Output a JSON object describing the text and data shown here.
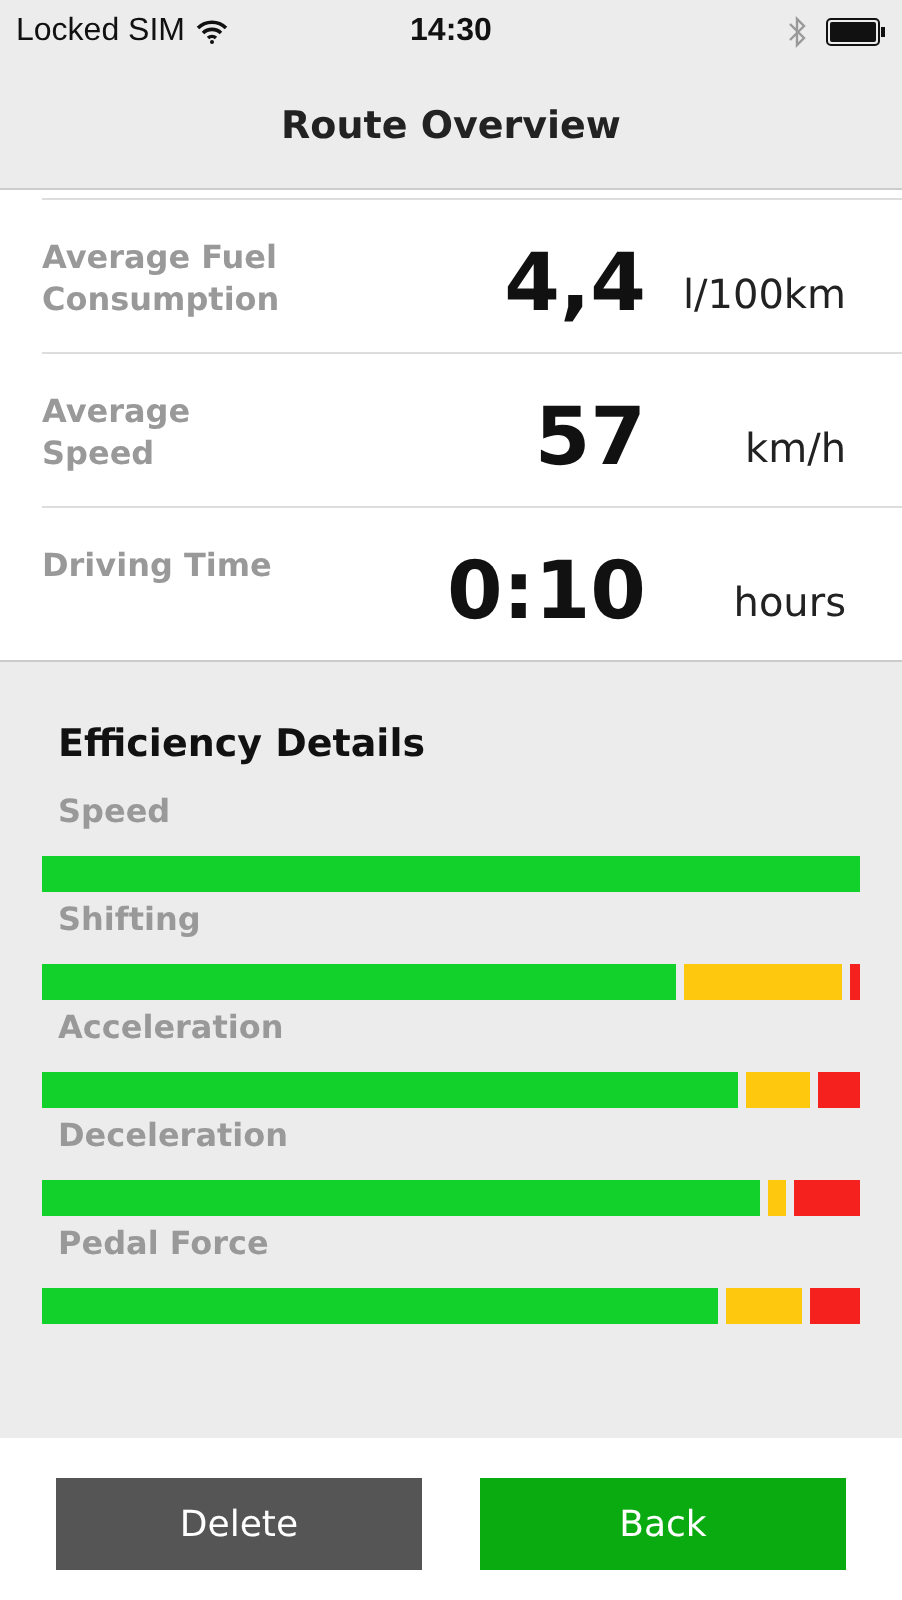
{
  "status_bar": {
    "carrier": "Locked SIM",
    "time": "14:30"
  },
  "nav": {
    "title": "Route Overview"
  },
  "metrics": [
    {
      "label": "Average Fuel Consumption",
      "value": "4,4",
      "unit": "l/100km"
    },
    {
      "label": "Average Speed",
      "value": "57",
      "unit": "km/h"
    },
    {
      "label": "Driving Time",
      "value": "0:10",
      "unit": "hours"
    }
  ],
  "efficiency": {
    "title": "Efficiency Details",
    "items": [
      {
        "label": "Speed",
        "level": 1.0
      },
      {
        "label": "Shifting",
        "level": 0.775
      },
      {
        "label": "Acceleration",
        "level": 0.851
      },
      {
        "label": "Deceleration",
        "level": 0.878
      },
      {
        "label": "Pedal Force",
        "level": 0.826
      }
    ]
  },
  "buttons": [
    {
      "label": "Delete",
      "kind": "secondary"
    },
    {
      "label": "Back",
      "kind": "primary"
    }
  ]
}
